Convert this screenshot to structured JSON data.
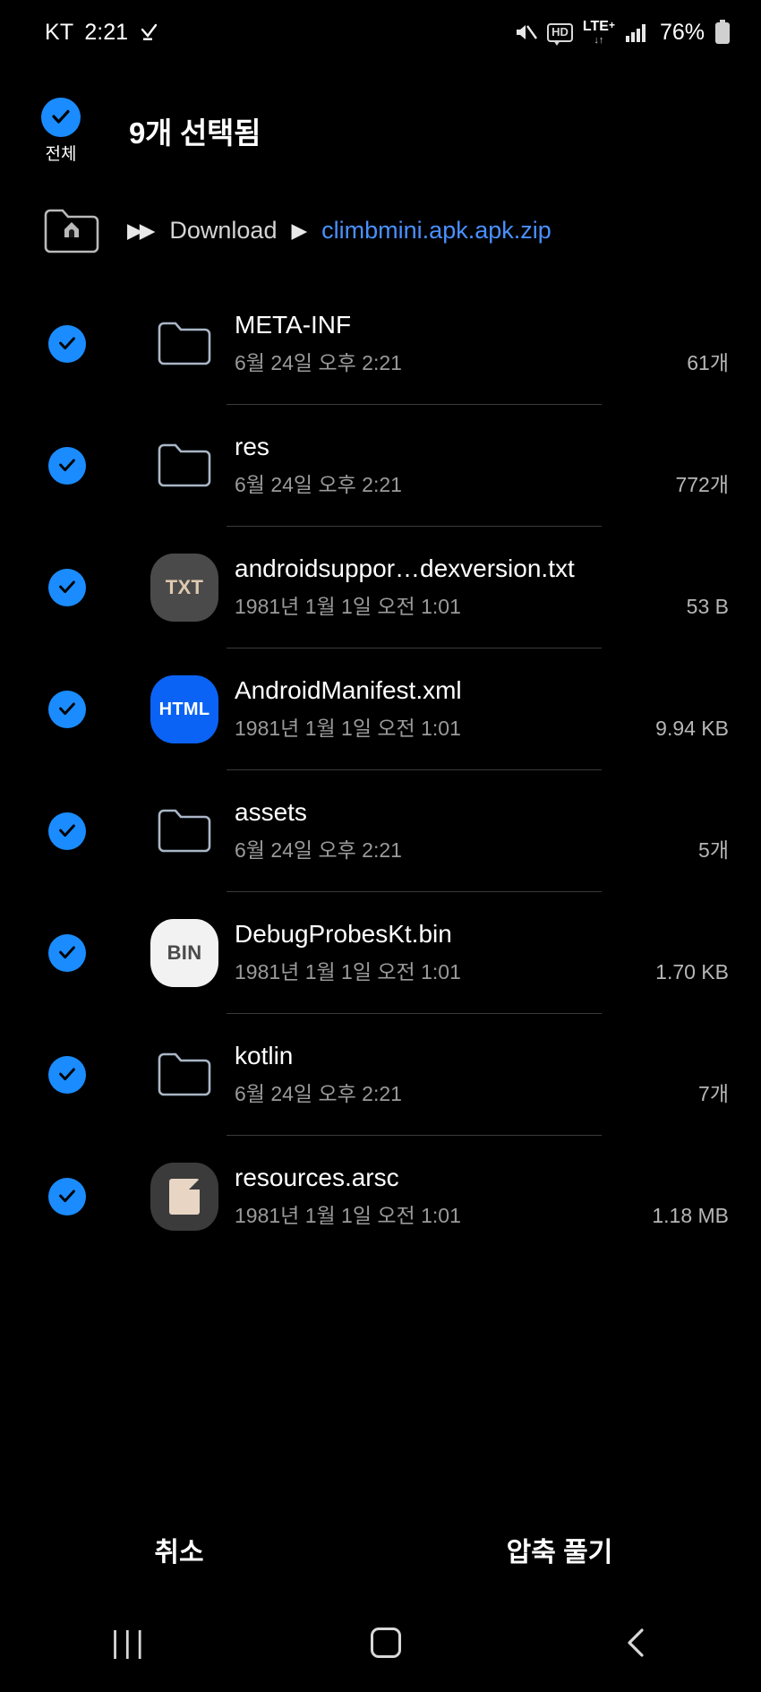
{
  "statusbar": {
    "carrier": "KT",
    "time": "2:21",
    "download_icon": "download-check-icon",
    "mute_icon": "mute-icon",
    "hd_label": "HD",
    "network_label": "LTE",
    "network_sup": "+",
    "network_arrows": "↓↑",
    "signal_icon": "signal-bars-icon",
    "battery_percent": "76%",
    "battery_icon": "battery-icon"
  },
  "header": {
    "select_all_label": "전체",
    "select_all_icon": "check-circle-icon",
    "title": "9개 선택됨"
  },
  "breadcrumb": {
    "home_icon": "home-folder-icon",
    "double_arrow": "▶▶",
    "arrow": "▶",
    "segments": [
      {
        "label": "Download",
        "current": false
      },
      {
        "label": "climbmini.apk.apk.zip",
        "current": true
      }
    ],
    "accent_color": "#4a90ff"
  },
  "files": [
    {
      "name": "META-INF",
      "date": "6월 24일 오후 2:21",
      "size": "61개",
      "icon": "folder-icon",
      "icon_type": "folder",
      "selected": true
    },
    {
      "name": "res",
      "date": "6월 24일 오후 2:21",
      "size": "772개",
      "icon": "folder-icon",
      "icon_type": "folder",
      "selected": true
    },
    {
      "name": "androidsuppor…dexversion.txt",
      "date": "1981년 1월 1일 오전 1:01",
      "size": "53 B",
      "icon": "txt-file-icon",
      "icon_type": "txt",
      "icon_label": "TXT",
      "selected": true
    },
    {
      "name": "AndroidManifest.xml",
      "date": "1981년 1월 1일 오전 1:01",
      "size": "9.94 KB",
      "icon": "html-file-icon",
      "icon_type": "html",
      "icon_label": "HTML",
      "selected": true
    },
    {
      "name": "assets",
      "date": "6월 24일 오후 2:21",
      "size": "5개",
      "icon": "folder-icon",
      "icon_type": "folder",
      "selected": true
    },
    {
      "name": "DebugProbesKt.bin",
      "date": "1981년 1월 1일 오전 1:01",
      "size": "1.70 KB",
      "icon": "bin-file-icon",
      "icon_type": "bin",
      "icon_label": "BIN",
      "selected": true
    },
    {
      "name": "kotlin",
      "date": "6월 24일 오후 2:21",
      "size": "7개",
      "icon": "folder-icon",
      "icon_type": "folder",
      "selected": true
    },
    {
      "name": "resources.arsc",
      "date": "1981년 1월 1일 오전 1:01",
      "size": "1.18 MB",
      "icon": "generic-file-icon",
      "icon_type": "generic",
      "selected": true
    }
  ],
  "actions": {
    "cancel_label": "취소",
    "extract_label": "압축 풀기"
  },
  "navbar": {
    "recents_icon": "recents-icon",
    "recents_glyph": "|||",
    "home_icon": "home-square-icon",
    "back_icon": "back-chevron-icon"
  },
  "colors": {
    "accent_blue": "#1a8cff",
    "link_blue": "#4a90ff",
    "background": "#000000"
  }
}
